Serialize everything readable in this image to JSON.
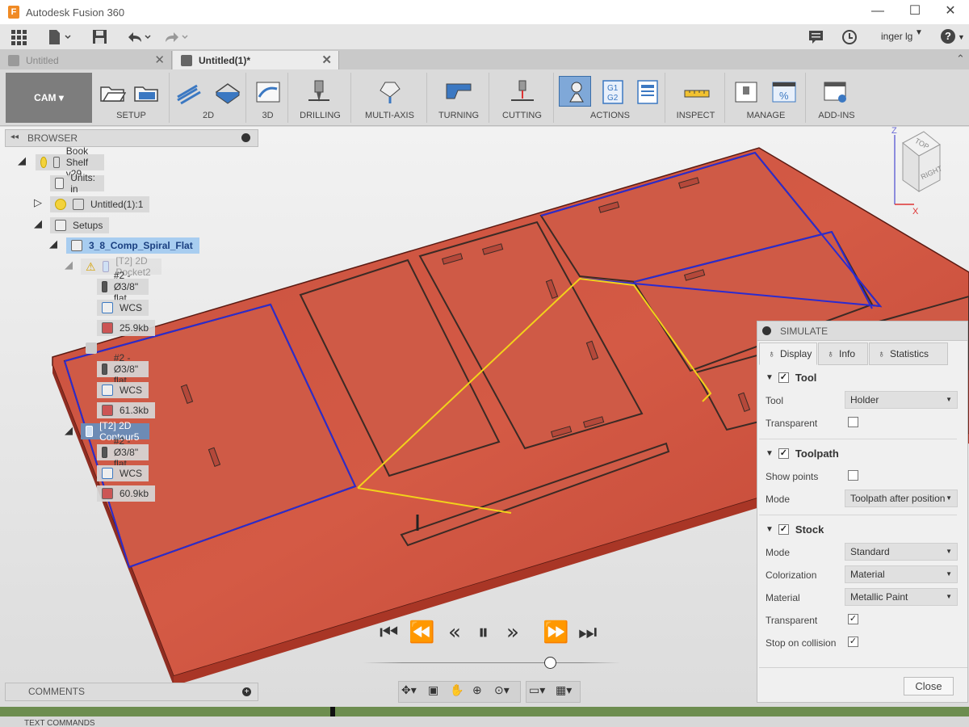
{
  "window": {
    "title": "Autodesk Fusion 360",
    "minimize": "—",
    "maximize": "☐",
    "close": "✕"
  },
  "quick_access": {
    "user": "inger lg",
    "help": "?"
  },
  "tabs": [
    {
      "label": "Untitled",
      "close": "✕"
    },
    {
      "label": "Untitled(1)*",
      "close": "✕"
    }
  ],
  "toolbar": {
    "workspace": "CAM",
    "groups": [
      "SETUP",
      "2D",
      "3D",
      "DRILLING",
      "MULTI-AXIS",
      "TURNING",
      "CUTTING",
      "ACTIONS",
      "INSPECT",
      "MANAGE",
      "ADD-INS"
    ]
  },
  "viewcube": {
    "top": "TOP",
    "right": "RIGHT",
    "x": "X",
    "z": "Z"
  },
  "browser": {
    "title": "BROWSER",
    "items": [
      {
        "label": "Book Shelf v29"
      },
      {
        "label": "Units: in"
      },
      {
        "label": "Untitled(1):1"
      },
      {
        "label": "Setups"
      },
      {
        "label": "3_8_Comp_Spiral_Flat"
      },
      {
        "label": "[T2] 2D Pocket2"
      },
      {
        "label": "#2 - Ø3/8\" flat"
      },
      {
        "label": "WCS"
      },
      {
        "label": "25.9kb"
      },
      {
        "label": "#2 - Ø3/8\" flat"
      },
      {
        "label": "WCS"
      },
      {
        "label": "61.3kb"
      },
      {
        "label": "[T2] 2D Contour5"
      },
      {
        "label": "#2 - Ø3/8\" flat"
      },
      {
        "label": "WCS"
      },
      {
        "label": "60.9kb"
      }
    ]
  },
  "simulate": {
    "title": "SIMULATE",
    "tabs": [
      "Display",
      "Info",
      "Statistics"
    ],
    "sections": {
      "tool": {
        "title": "Tool",
        "tool_label": "Tool",
        "tool_value": "Holder",
        "transparent_label": "Transparent"
      },
      "toolpath": {
        "title": "Toolpath",
        "show_points_label": "Show points",
        "mode_label": "Mode",
        "mode_value": "Toolpath after position"
      },
      "stock": {
        "title": "Stock",
        "mode_label": "Mode",
        "mode_value": "Standard",
        "colorization_label": "Colorization",
        "colorization_value": "Material",
        "material_label": "Material",
        "material_value": "Metallic Paint",
        "transparent_label": "Transparent",
        "collision_label": "Stop on collision"
      }
    },
    "close": "Close"
  },
  "comments": {
    "title": "COMMENTS"
  },
  "text_commands": {
    "title": "TEXT COMMANDS"
  },
  "colors": {
    "stock": "#c9473a",
    "toolpath": "#f2d21b",
    "contour": "#2b2bd0",
    "accent": "#3b78c2"
  }
}
